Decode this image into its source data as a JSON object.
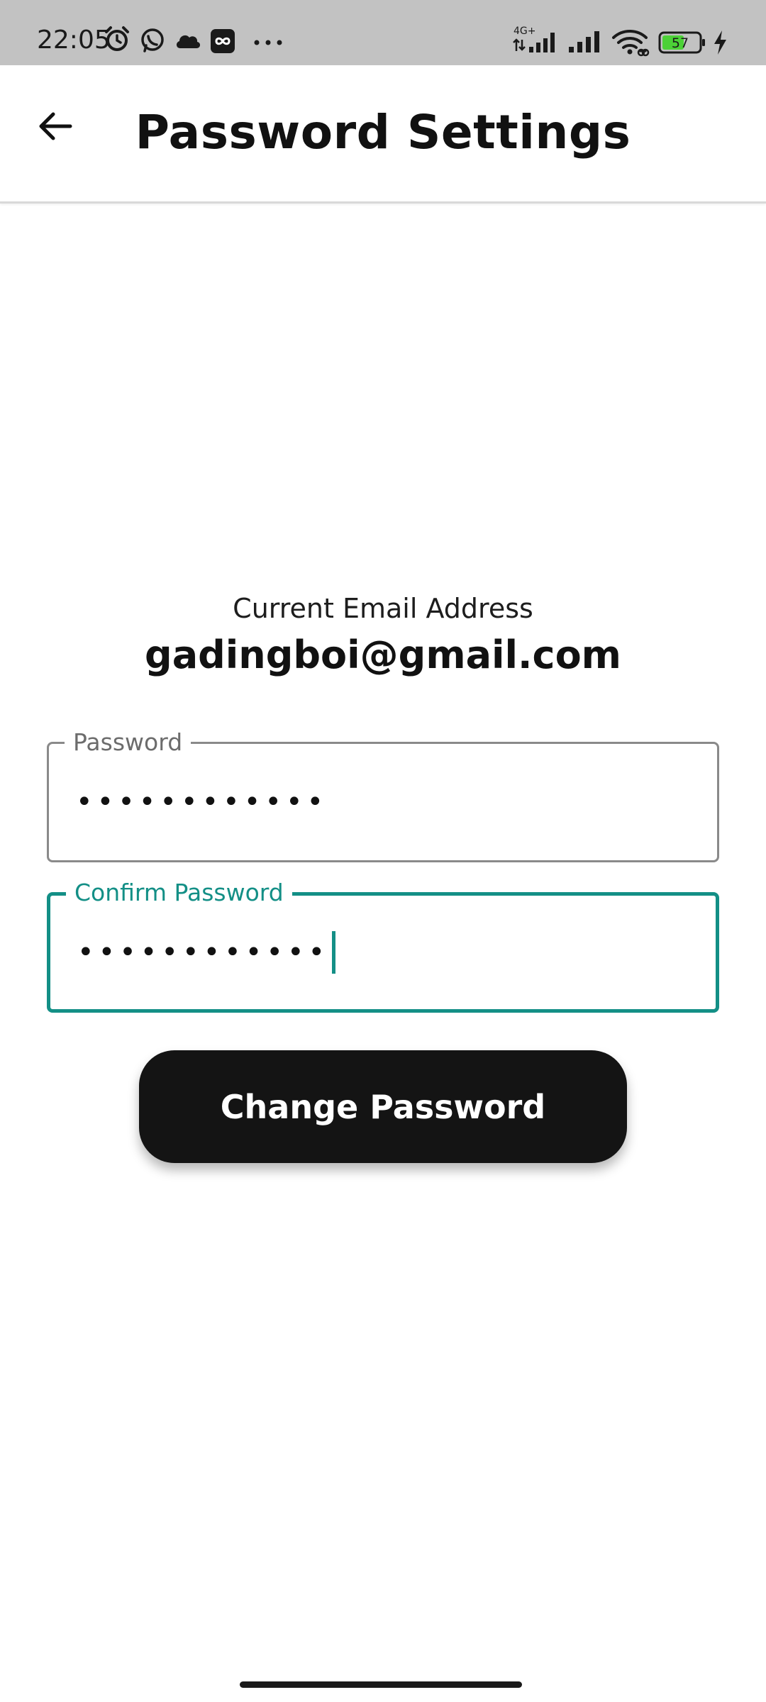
{
  "status_bar": {
    "time": "22:05",
    "network_label": "4G+",
    "battery_level": "57",
    "left_icons": [
      "alarm-icon",
      "whatsapp-icon",
      "cloud-icon",
      "infinity-app-icon",
      "more-dots-icon"
    ],
    "right_icons": [
      "signal-4g-icon",
      "signal-icon",
      "wifi-icon",
      "battery-icon",
      "charging-icon"
    ],
    "battery_color": "#4cd137"
  },
  "app_bar": {
    "back_icon": "arrow-left-icon",
    "title": "Password Settings"
  },
  "account": {
    "email_caption": "Current Email Address",
    "email": "gadingboi@gmail.com"
  },
  "form": {
    "password": {
      "label": "Password",
      "value": "••••••••••••"
    },
    "confirm_password": {
      "label": "Confirm Password",
      "value": "••••••••••••",
      "focused": true
    },
    "submit_label": "Change Password"
  },
  "colors": {
    "accent": "#138f86",
    "button_background": "#141414",
    "status_bar_background": "#c2c2c2"
  }
}
